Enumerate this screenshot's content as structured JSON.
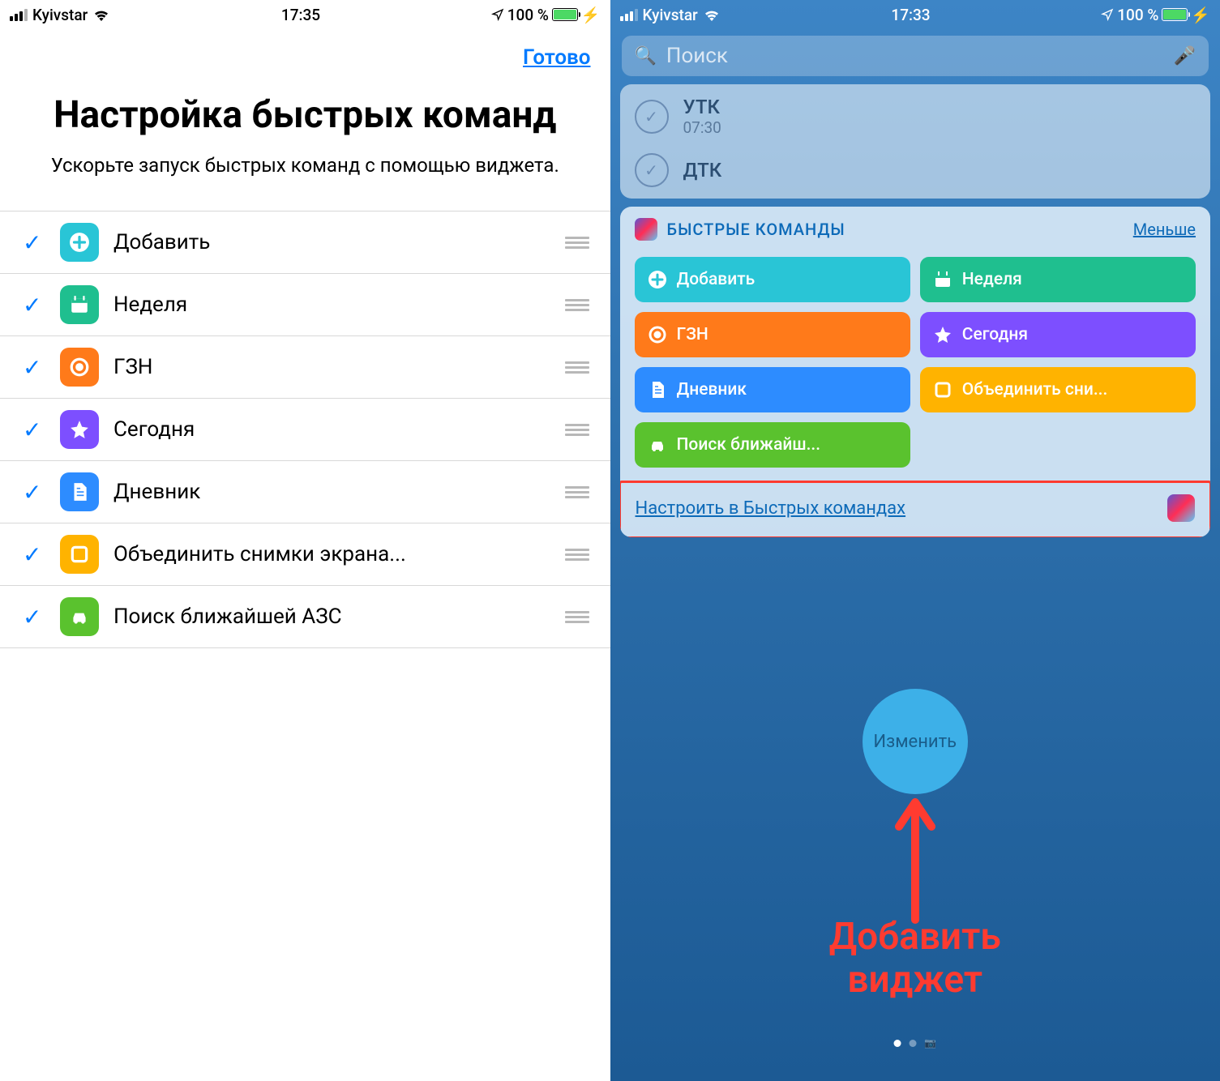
{
  "left": {
    "status": {
      "carrier": "Kyivstar",
      "time": "17:35",
      "battery": "100 %"
    },
    "done": "Готово",
    "title": "Настройка быстрых команд",
    "subtitle": "Ускорьте запуск быстрых команд с помощью виджета.",
    "items": [
      {
        "label": "Добавить",
        "icon": "plus",
        "color": "#29c5d6"
      },
      {
        "label": "Неделя",
        "icon": "calendar",
        "color": "#1fbf8f"
      },
      {
        "label": "ГЗН",
        "icon": "target",
        "color": "#ff7a1a"
      },
      {
        "label": "Сегодня",
        "icon": "star",
        "color": "#7d4fff"
      },
      {
        "label": "Дневник",
        "icon": "doc",
        "color": "#2d8cff"
      },
      {
        "label": "Объединить снимки экрана...",
        "icon": "square",
        "color": "#ffb300"
      },
      {
        "label": "Поиск ближайшей АЗС",
        "icon": "car",
        "color": "#5ac22e"
      }
    ]
  },
  "right": {
    "status": {
      "carrier": "Kyivstar",
      "time": "17:33",
      "battery": "100 %"
    },
    "search_placeholder": "Поиск",
    "top_items": [
      {
        "title": "УТК",
        "sub": "07:30"
      },
      {
        "title": "ДТК",
        "sub": ""
      }
    ],
    "widget": {
      "title": "БЫСТРЫЕ КОМАНДЫ",
      "less": "Меньше",
      "tiles": [
        {
          "label": "Добавить",
          "icon": "plus",
          "color": "#29c5d6"
        },
        {
          "label": "Неделя",
          "icon": "calendar",
          "color": "#1fbf8f"
        },
        {
          "label": "ГЗН",
          "icon": "target",
          "color": "#ff7a1a"
        },
        {
          "label": "Сегодня",
          "icon": "star",
          "color": "#7d4fff"
        },
        {
          "label": "Дневник",
          "icon": "doc",
          "color": "#2d8cff"
        },
        {
          "label": "Объединить сни...",
          "icon": "square",
          "color": "#ffb300"
        },
        {
          "label": "Поиск ближайш...",
          "icon": "car",
          "color": "#5ac22e"
        }
      ],
      "footer": "Настроить в Быстрых командах"
    },
    "edit": "Изменить",
    "annotation": "Добавить виджет"
  }
}
